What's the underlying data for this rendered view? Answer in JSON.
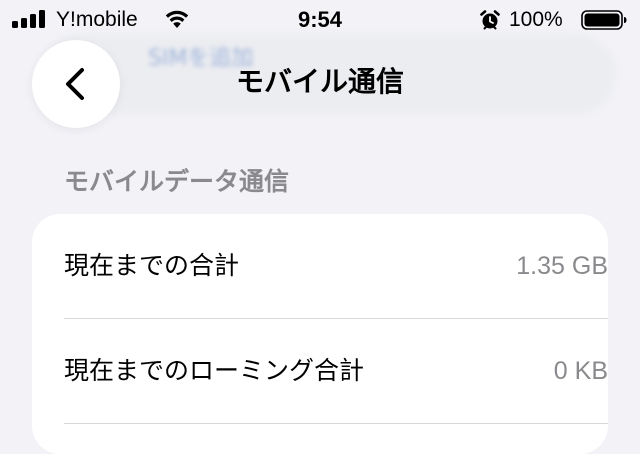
{
  "status_bar": {
    "carrier": "Y!mobile",
    "time": "9:54",
    "battery_percent": "100%"
  },
  "background": {
    "blurred_button_label": "SIMを追加"
  },
  "nav": {
    "title": "モバイル通信"
  },
  "section": {
    "header": "モバイルデータ通信",
    "rows": [
      {
        "label": "現在までの合計",
        "value": "1.35 GB"
      },
      {
        "label": "現在までのローミング合計",
        "value": "0 KB"
      }
    ]
  },
  "colors": {
    "background": "#f2f2f7",
    "card": "#ffffff",
    "secondary_text": "#8a8a8e",
    "divider": "#d8d8dc"
  },
  "icons": {
    "back": "chevron-left-icon",
    "signal": "cellular-signal-icon",
    "wifi": "wifi-icon",
    "alarm": "alarm-clock-icon",
    "battery": "battery-full-icon"
  }
}
